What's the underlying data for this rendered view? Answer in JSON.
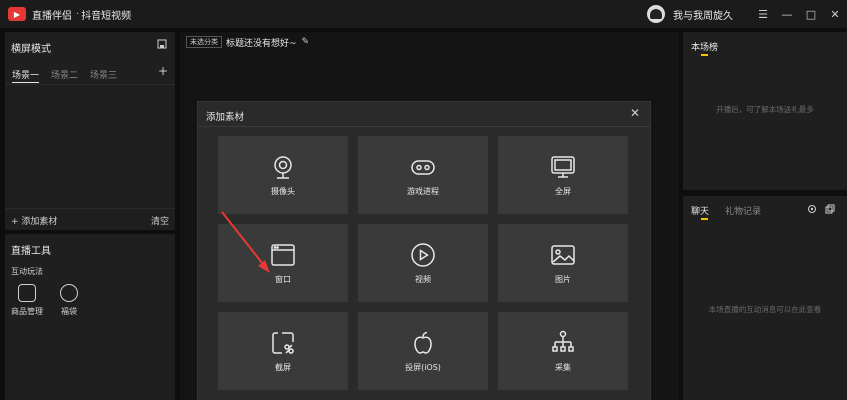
{
  "titlebar": {
    "app_name": "直播伴侣",
    "separator": "·",
    "app_sub": "抖音短视频",
    "username": "我与我周旋久",
    "min_glyph": "—",
    "max_glyph": "□",
    "close_glyph": "✕",
    "menu_glyph": "☰"
  },
  "left_top": {
    "title": "横屏模式",
    "scenes": [
      "场景一",
      "场景二",
      "场景三"
    ],
    "add_scene": "+",
    "add_source": "+ 添加素材",
    "clear": "清空"
  },
  "left_bottom": {
    "title": "直播工具",
    "subtitle": "互动玩法",
    "tools": [
      "商品管理",
      "福袋"
    ]
  },
  "center": {
    "category_badge": "未选分类",
    "stream_title": "标题还没有想好~"
  },
  "right_top": {
    "title": "本场榜",
    "empty": "开播后，可了解本场送礼最多"
  },
  "right_bottom": {
    "tabs": [
      "聊天",
      "礼物记录"
    ],
    "empty": "本场直播的互动消息可以在此查看"
  },
  "modal": {
    "title": "添加素材",
    "close": "✕",
    "tiles": [
      {
        "label": "摄像头",
        "icon": "camera-icon"
      },
      {
        "label": "游戏进程",
        "icon": "gamepad-icon"
      },
      {
        "label": "全屏",
        "icon": "monitor-icon"
      },
      {
        "label": "窗口",
        "icon": "window-icon"
      },
      {
        "label": "视频",
        "icon": "play-icon"
      },
      {
        "label": "图片",
        "icon": "image-icon"
      },
      {
        "label": "截屏",
        "icon": "screenshot-icon"
      },
      {
        "label": "投屏(iOS)",
        "icon": "apple-icon"
      },
      {
        "label": "采集",
        "icon": "network-icon"
      }
    ]
  },
  "colors": {
    "accent": "#f5c400",
    "brand": "#e53935",
    "arrow": "#e53935"
  }
}
